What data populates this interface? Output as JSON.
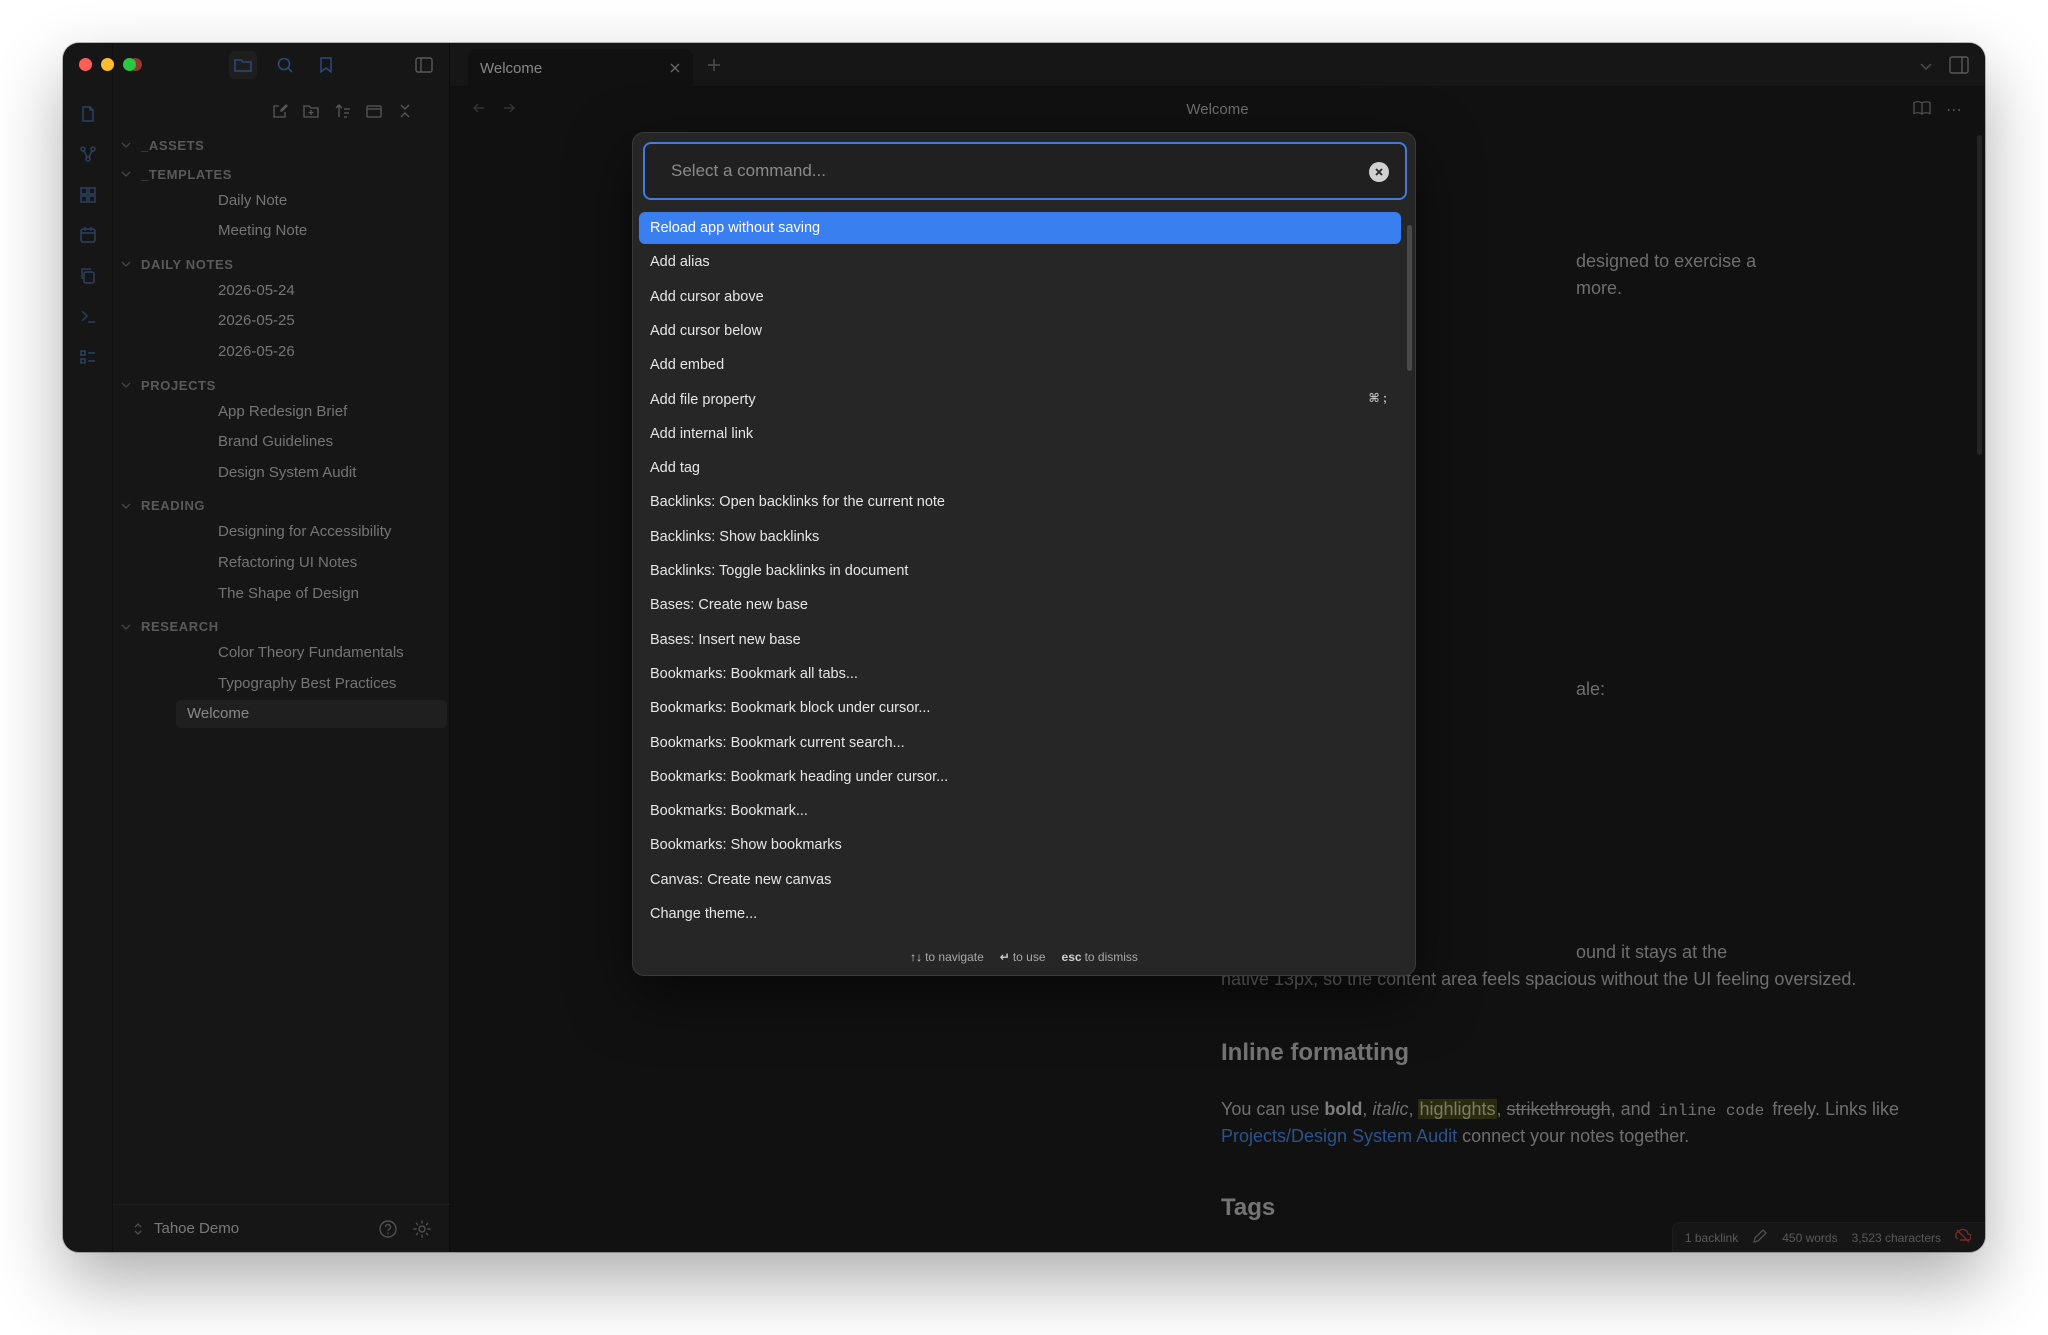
{
  "sidebar": {
    "folders": [
      {
        "name": "_ASSETS",
        "files": []
      },
      {
        "name": "_TEMPLATES",
        "files": [
          "Daily Note",
          "Meeting Note"
        ]
      },
      {
        "name": "DAILY NOTES",
        "files": [
          "2026-05-24",
          "2026-05-25",
          "2026-05-26"
        ]
      },
      {
        "name": "PROJECTS",
        "files": [
          "App Redesign Brief",
          "Brand Guidelines",
          "Design System Audit"
        ]
      },
      {
        "name": "READING",
        "files": [
          "Designing for Accessibility",
          "Refactoring UI Notes",
          "The Shape of Design"
        ]
      },
      {
        "name": "RESEARCH",
        "files": [
          "Color Theory Fundamentals",
          "Typography Best Practices"
        ]
      }
    ],
    "root_file": "Welcome",
    "vault_name": "Tahoe Demo"
  },
  "tabs": {
    "active_label": "Welcome"
  },
  "view": {
    "title": "Welcome"
  },
  "document": {
    "frag_intro_1": "designed to exercise a",
    "frag_intro_2": "more.",
    "frag_scale": "ale:",
    "frag_body_1": "ound it stays at the",
    "frag_body_2": "native 13px, so the content area feels spacious without the UI feeling oversized.",
    "heading_inline": "Inline formatting",
    "inline_prefix": "You can use ",
    "bold": "bold",
    "sep1": ", ",
    "italic": "italic",
    "sep2": ", ",
    "highlight": "highlights",
    "sep3": ", ",
    "strike": "strikethrough",
    "sep4": ", and ",
    "code": "inline code",
    "inline_suffix": " freely. Links like",
    "link": "Projects/Design System Audit",
    "link_suffix": " connect your notes together.",
    "heading_tags": "Tags"
  },
  "status_bar": {
    "backlinks": "1 backlink",
    "words": "450 words",
    "characters": "3,523 characters"
  },
  "palette": {
    "placeholder": "Select a command...",
    "commands": [
      {
        "label": "Reload app without saving",
        "shortcut": "",
        "selected": true
      },
      {
        "label": "Add alias",
        "shortcut": ""
      },
      {
        "label": "Add cursor above",
        "shortcut": ""
      },
      {
        "label": "Add cursor below",
        "shortcut": ""
      },
      {
        "label": "Add embed",
        "shortcut": ""
      },
      {
        "label": "Add file property",
        "shortcut": "⌘ ;"
      },
      {
        "label": "Add internal link",
        "shortcut": ""
      },
      {
        "label": "Add tag",
        "shortcut": ""
      },
      {
        "label": "Backlinks: Open backlinks for the current note",
        "shortcut": ""
      },
      {
        "label": "Backlinks: Show backlinks",
        "shortcut": ""
      },
      {
        "label": "Backlinks: Toggle backlinks in document",
        "shortcut": ""
      },
      {
        "label": "Bases: Create new base",
        "shortcut": ""
      },
      {
        "label": "Bases: Insert new base",
        "shortcut": ""
      },
      {
        "label": "Bookmarks: Bookmark all tabs...",
        "shortcut": ""
      },
      {
        "label": "Bookmarks: Bookmark block under cursor...",
        "shortcut": ""
      },
      {
        "label": "Bookmarks: Bookmark current search...",
        "shortcut": ""
      },
      {
        "label": "Bookmarks: Bookmark heading under cursor...",
        "shortcut": ""
      },
      {
        "label": "Bookmarks: Bookmark...",
        "shortcut": ""
      },
      {
        "label": "Bookmarks: Show bookmarks",
        "shortcut": ""
      },
      {
        "label": "Canvas: Create new canvas",
        "shortcut": ""
      },
      {
        "label": "Change theme...",
        "shortcut": ""
      }
    ],
    "footer": {
      "navigate_key": "↑↓",
      "navigate_label": "to navigate",
      "use_key": "↵",
      "use_label": "to use",
      "dismiss_key": "esc",
      "dismiss_label": "to dismiss"
    }
  },
  "colors": {
    "accent": "#3a7ff0",
    "link": "#4d8ef0",
    "highlight_bg": "#4a4a1e",
    "ribbon_icon": "#4a6fa8"
  }
}
